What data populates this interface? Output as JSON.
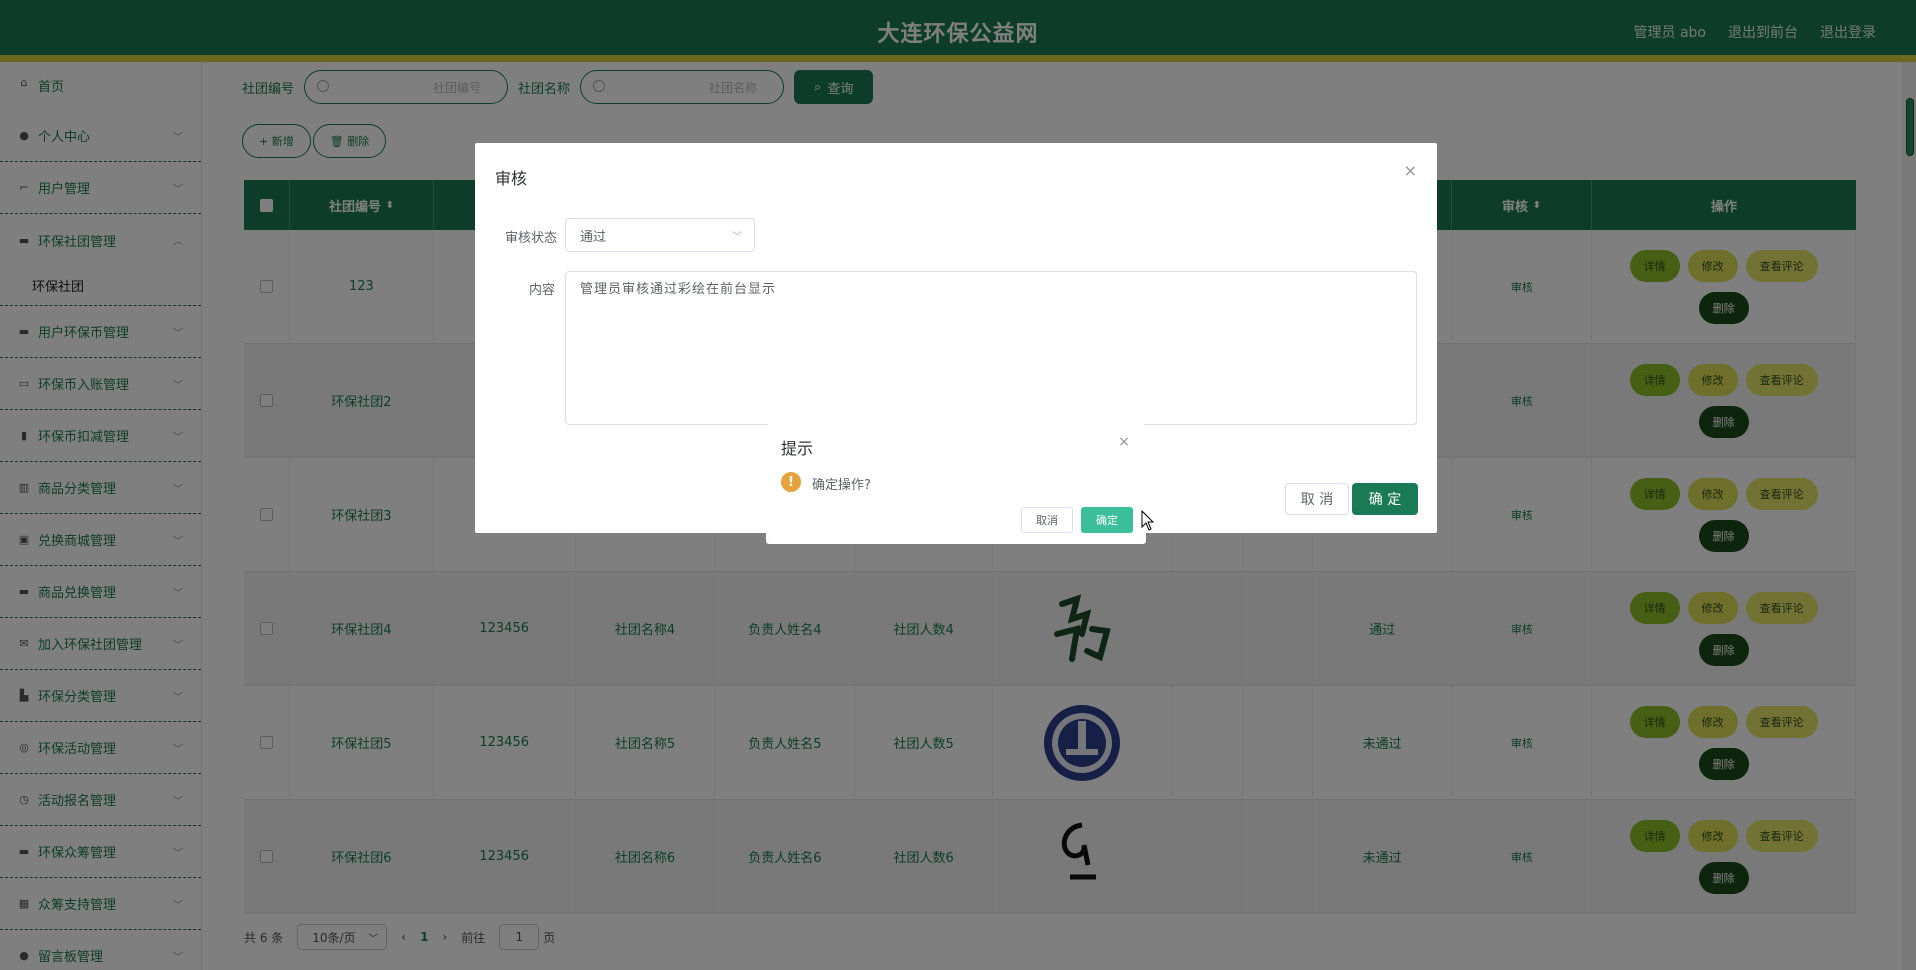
{
  "header": {
    "title": "大连环保公益网",
    "admin": "管理员 abo",
    "to_front": "退出到前台",
    "logout": "退出登录"
  },
  "sidebar": {
    "items": [
      {
        "label": "首页",
        "icon": "home-icon"
      },
      {
        "label": "个人中心",
        "icon": "user-icon"
      },
      {
        "label": "用户管理",
        "icon": "crop-icon"
      },
      {
        "label": "环保社团管理",
        "icon": "flag-icon"
      },
      {
        "label": "用户环保币管理",
        "icon": "monitor-icon"
      },
      {
        "label": "环保币入账管理",
        "icon": "wallet-icon"
      },
      {
        "label": "环保币扣减管理",
        "icon": "clipboard-icon"
      },
      {
        "label": "商品分类管理",
        "icon": "chart-icon"
      },
      {
        "label": "兑换商城管理",
        "icon": "picture-icon"
      },
      {
        "label": "商品兑换管理",
        "icon": "chat-icon"
      },
      {
        "label": "加入环保社团管理",
        "icon": "mail-icon"
      },
      {
        "label": "环保分类管理",
        "icon": "thumb-icon"
      },
      {
        "label": "环保活动管理",
        "icon": "globe-icon"
      },
      {
        "label": "活动报名管理",
        "icon": "clock-icon"
      },
      {
        "label": "环保众筹管理",
        "icon": "monitor-icon"
      },
      {
        "label": "众筹支持管理",
        "icon": "grid-icon"
      },
      {
        "label": "留言板管理",
        "icon": "dot-icon"
      }
    ],
    "sub_item": "环保社团"
  },
  "search": {
    "id_label": "社团编号",
    "id_placeholder": "社团编号",
    "name_label": "社团名称",
    "name_placeholder": "社团名称",
    "query": "查询"
  },
  "toolbar": {
    "add": "新增",
    "delete": "删除"
  },
  "table": {
    "headers": {
      "id": "社团编号",
      "audit": "审核",
      "ops": "操作"
    },
    "rows": [
      {
        "id": "123",
        "account": "",
        "name": "",
        "leader": "",
        "count": "",
        "status": "",
        "logo": false
      },
      {
        "id": "环保社团2",
        "account": "",
        "name": "",
        "leader": "",
        "count": "",
        "status": "",
        "logo": false
      },
      {
        "id": "环保社团3",
        "account": "",
        "name": "",
        "leader": "",
        "count": "",
        "status": "",
        "logo": false
      },
      {
        "id": "环保社团4",
        "account": "123456",
        "name": "社团名称4",
        "leader": "负责人姓名4",
        "count": "社团人数4",
        "status": "通过",
        "logo": true
      },
      {
        "id": "环保社团5",
        "account": "123456",
        "name": "社团名称5",
        "leader": "负责人姓名5",
        "count": "社团人数5",
        "status": "未通过",
        "logo": true
      },
      {
        "id": "环保社团6",
        "account": "123456",
        "name": "社团名称6",
        "leader": "负责人姓名6",
        "count": "社团人数6",
        "status": "未通过",
        "logo": true
      }
    ],
    "audit_link": "审核",
    "op_view": "详情",
    "op_edit": "修改",
    "op_comment": "查看评论",
    "op_delete": "删除"
  },
  "pager": {
    "total": "共 6 条",
    "page_size": "10条/页",
    "current": "1",
    "goto_label": "前往",
    "goto_value": "1",
    "page_unit": "页"
  },
  "audit_dialog": {
    "title": "审核",
    "status_label": "审核状态",
    "status_value": "通过",
    "content_label": "内容",
    "content_value": "管理员审核通过彩绘在前台显示",
    "cancel": "取 消",
    "ok": "确 定"
  },
  "confirm": {
    "title": "提示",
    "message": "确定操作?",
    "cancel": "取消",
    "ok": "确定"
  },
  "colors": {
    "primary": "#1a7a55",
    "stripe": "#d6d23c",
    "warning": "#e6a23c",
    "confirm_ok": "#3bbf9a"
  }
}
